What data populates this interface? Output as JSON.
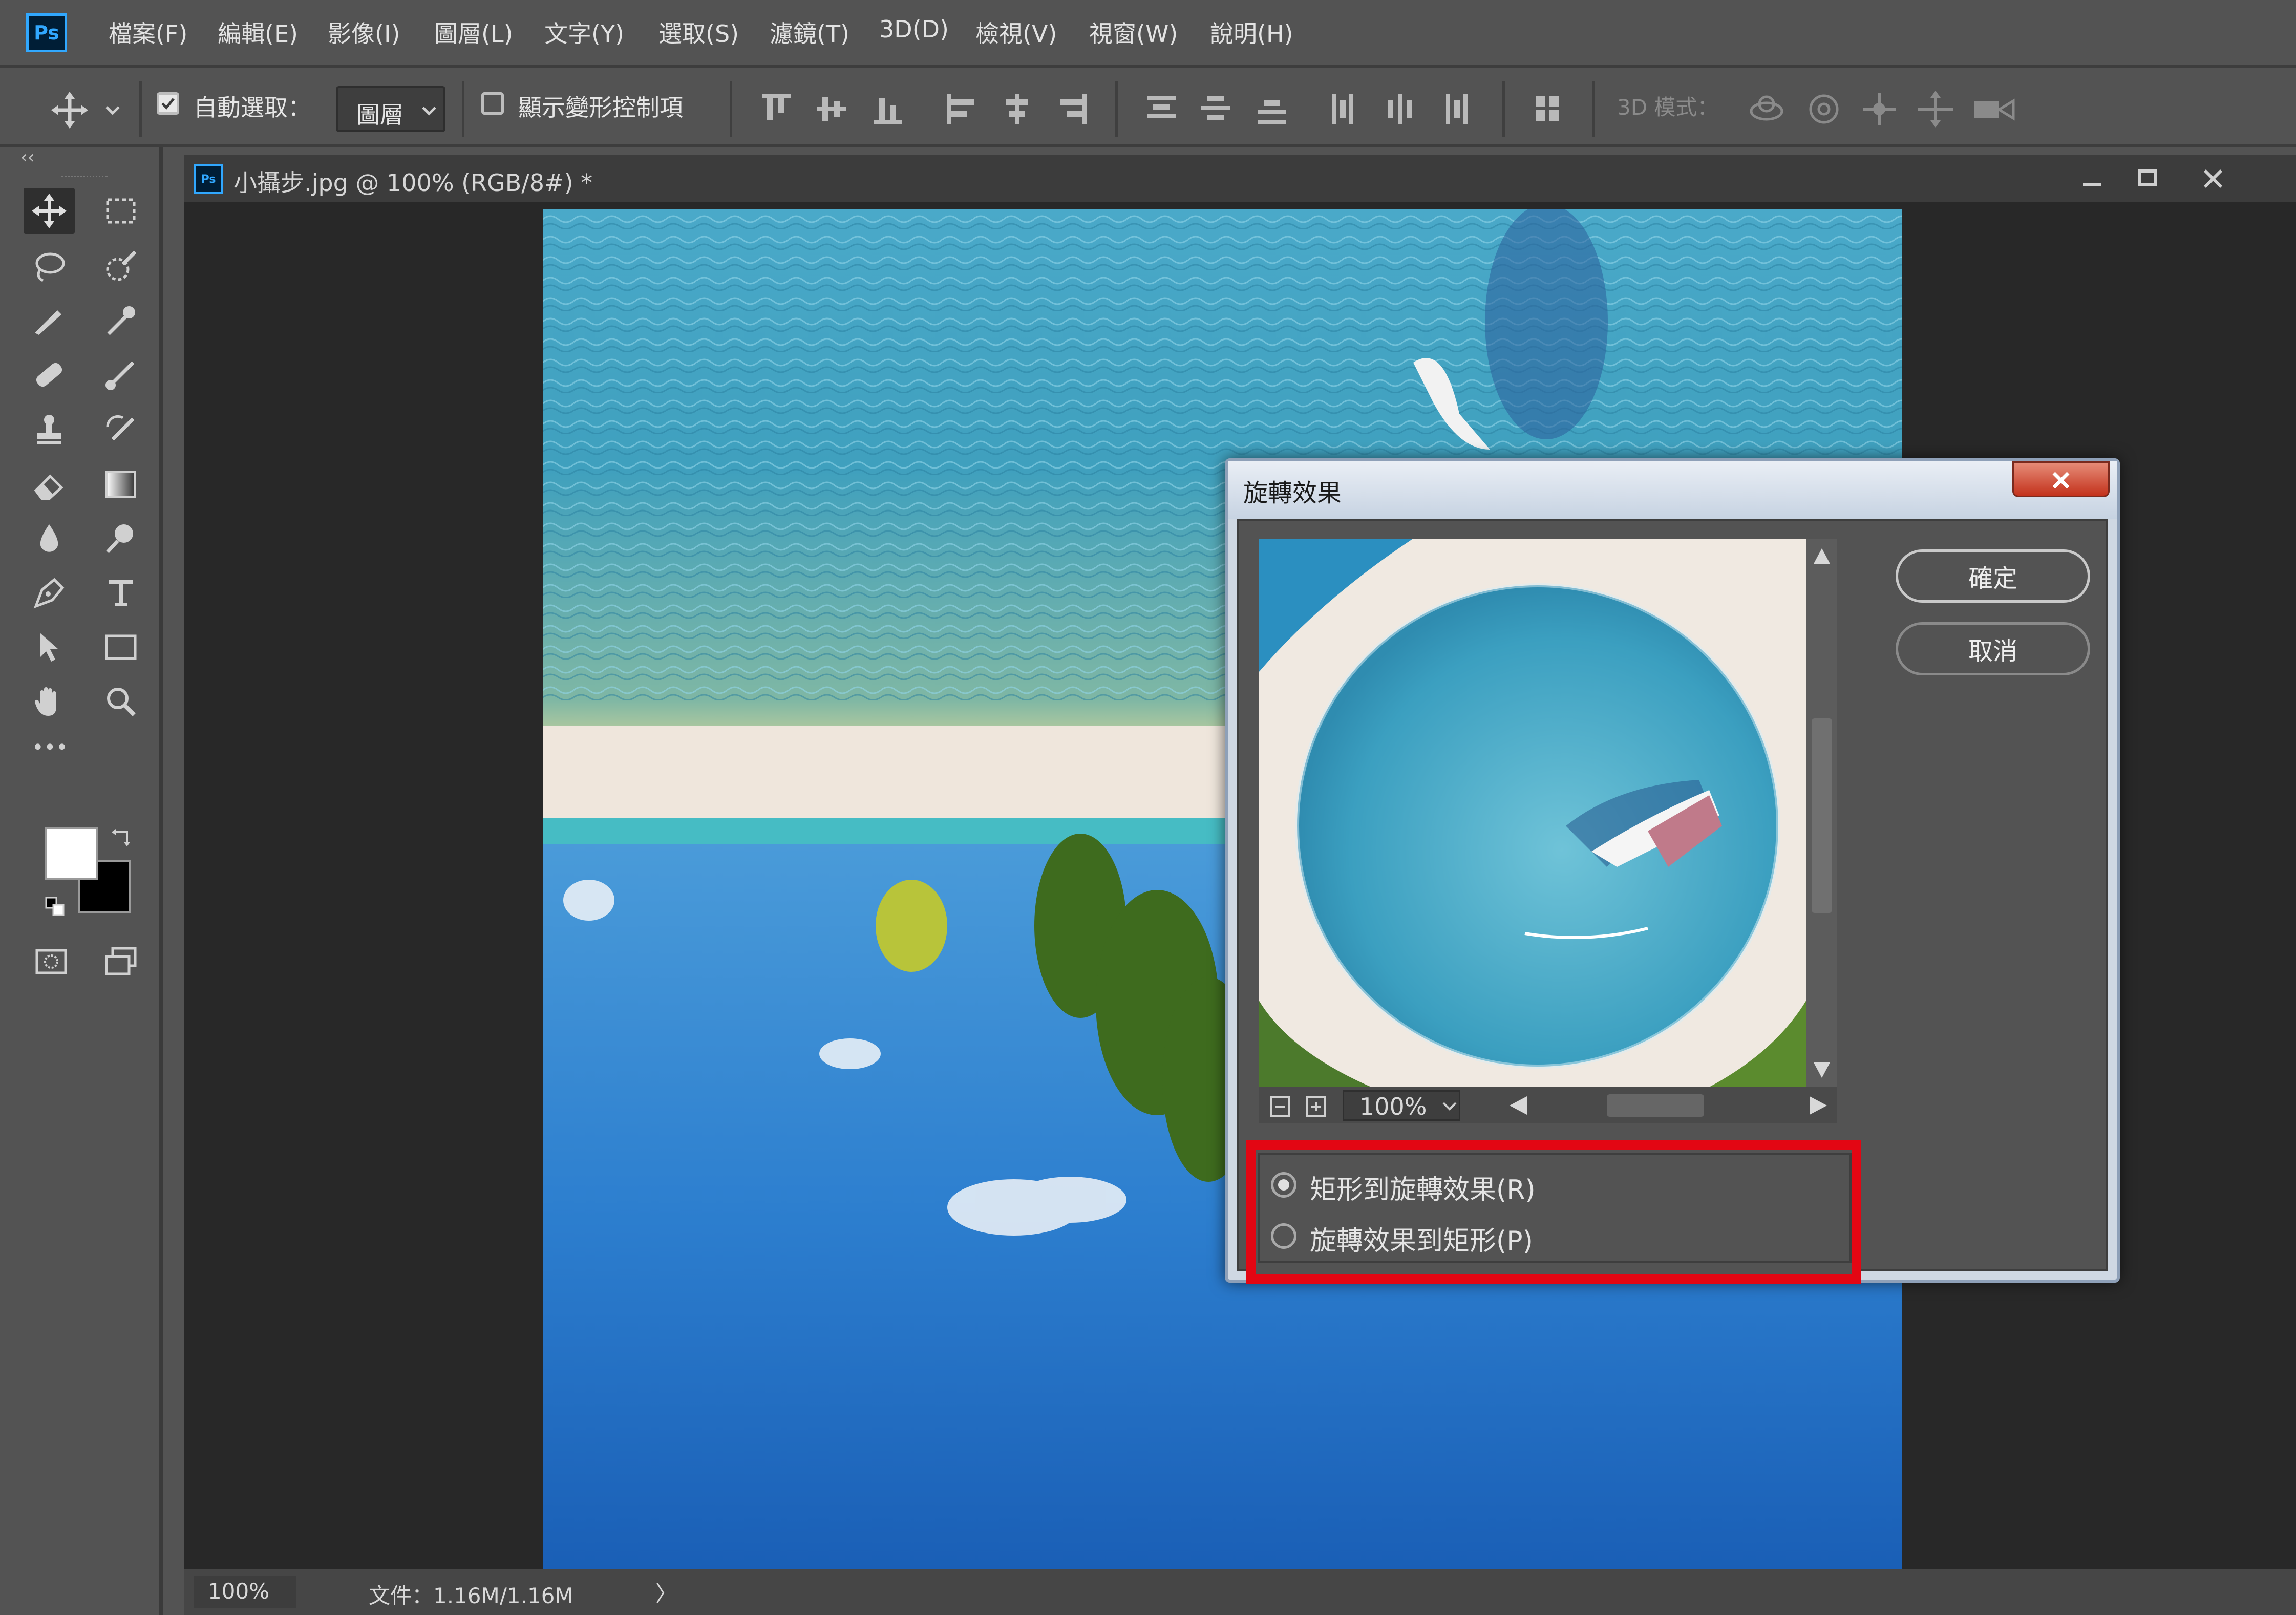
{
  "app": {
    "logo": "Ps"
  },
  "menu": [
    "檔案(F)",
    "編輯(E)",
    "影像(I)",
    "圖層(L)",
    "文字(Y)",
    "選取(S)",
    "濾鏡(T)",
    "3D(D)",
    "檢視(V)",
    "視窗(W)",
    "說明(H)"
  ],
  "options": {
    "auto_select_label": "自動選取：",
    "auto_select_checked": true,
    "auto_select_target": "圖層",
    "show_transform_label": "顯示變形控制項",
    "show_transform_checked": false,
    "mode_3d_label": "3D 模式："
  },
  "toolbar": {
    "collapse_glyph": "‹‹",
    "more_glyph": "•••"
  },
  "document": {
    "title": "小攝步.jpg @ 100% (RGB/8#) *",
    "zoom": "100%",
    "file_info": "文件：1.16M/1.16M",
    "status_arrow": "〉"
  },
  "dialog": {
    "title": "旋轉效果",
    "ok_label": "確定",
    "cancel_label": "取消",
    "preview_zoom": "100%",
    "options": [
      {
        "label": "矩形到旋轉效果(R)",
        "selected": true
      },
      {
        "label": "旋轉效果到矩形(P)",
        "selected": false
      }
    ],
    "highlight_color": "#e30613"
  },
  "colors": {
    "accent": "#31a8ff",
    "foreground_swatch": "#ffffff",
    "background_swatch": "#000000"
  }
}
